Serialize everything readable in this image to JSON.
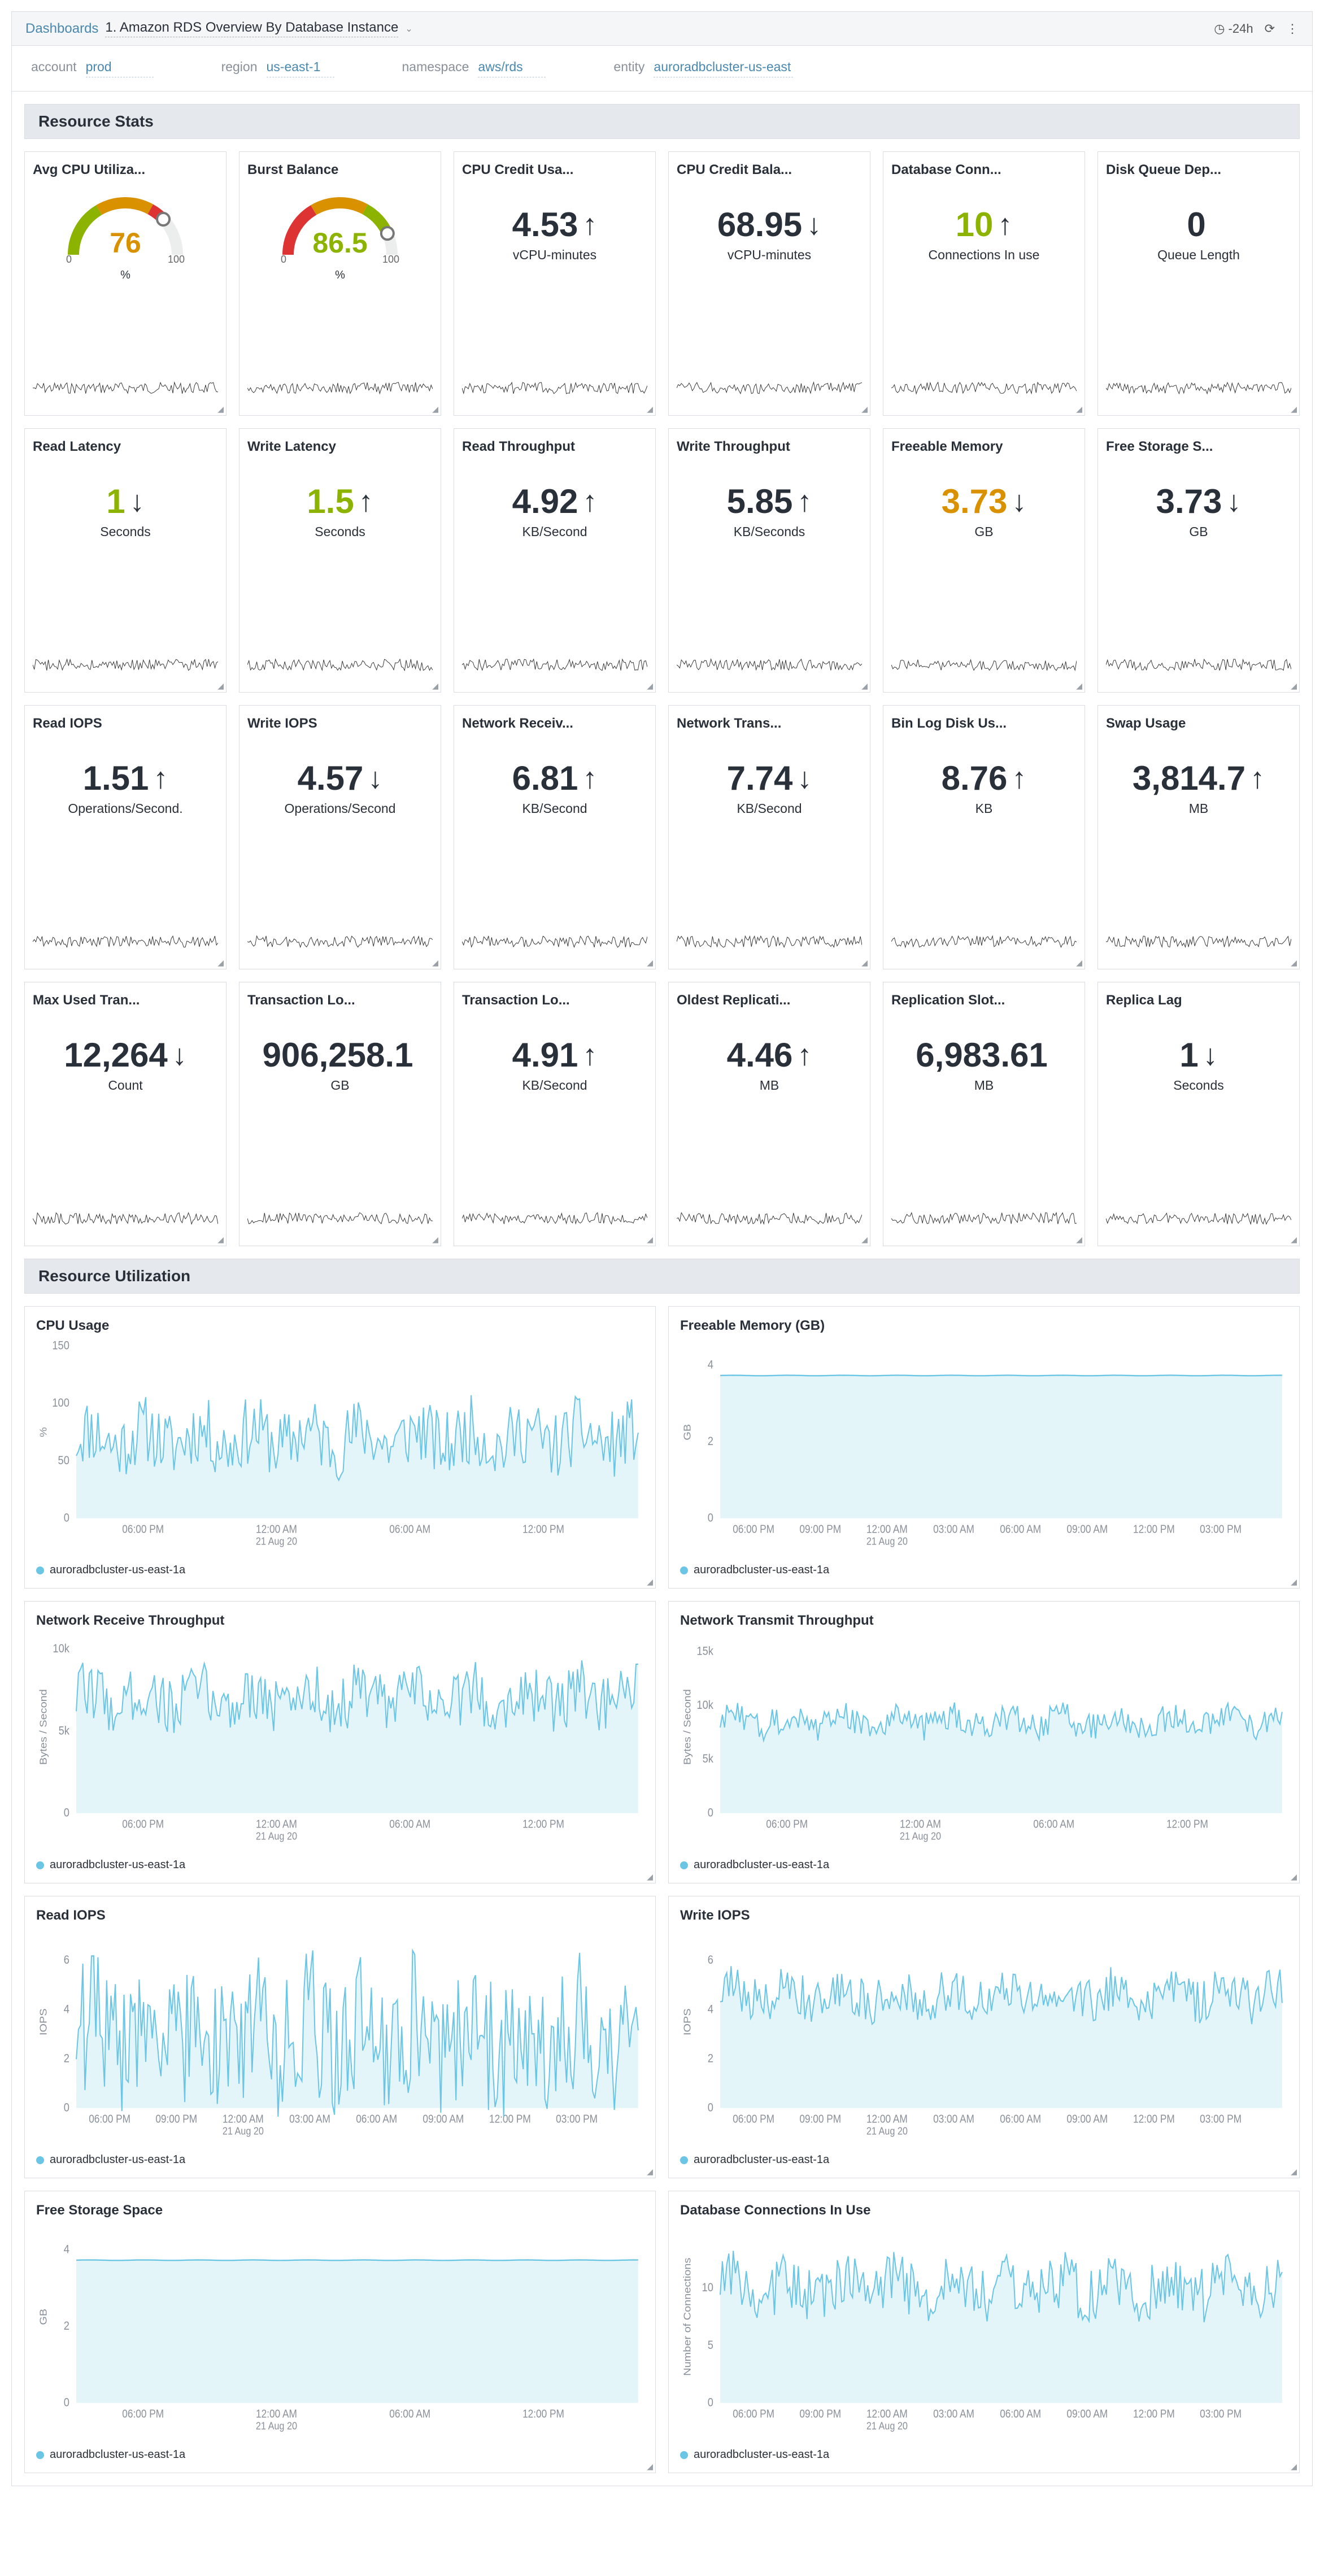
{
  "crumb": {
    "label": "Dashboards",
    "title": "1. Amazon RDS Overview By Database Instance"
  },
  "timerange": "-24h",
  "filters": {
    "account": {
      "label": "account",
      "value": "prod"
    },
    "region": {
      "label": "region",
      "value": "us-east-1"
    },
    "namespace": {
      "label": "namespace",
      "value": "aws/rds"
    },
    "entity": {
      "label": "entity",
      "value": "auroradbcluster-us-east"
    }
  },
  "section1": "Resource Stats",
  "section2": "Resource Utilization",
  "legend_series": "auroradbcluster-us-east-1a",
  "stats": [
    {
      "title": "Avg CPU Utiliza...",
      "type": "gauge",
      "value": "76",
      "unit": "%",
      "color": "orange",
      "min": "0",
      "max": "100"
    },
    {
      "title": "Burst Balance",
      "type": "gauge",
      "value": "86.5",
      "unit": "%",
      "color": "green",
      "min": "0",
      "max": "100"
    },
    {
      "title": "CPU Credit Usa...",
      "value": "4.53",
      "arrow": "up",
      "unit": "vCPU-minutes"
    },
    {
      "title": "CPU Credit Bala...",
      "value": "68.95",
      "arrow": "down",
      "unit": "vCPU-minutes"
    },
    {
      "title": "Database Conn...",
      "value": "10",
      "arrow": "up",
      "unit": "Connections In use",
      "valcolor": "green"
    },
    {
      "title": "Disk Queue Dep...",
      "value": "0",
      "arrow": "",
      "unit": "Queue Length"
    },
    {
      "title": "Read Latency",
      "value": "1",
      "arrow": "down",
      "unit": "Seconds",
      "valcolor": "green"
    },
    {
      "title": "Write Latency",
      "value": "1.5",
      "arrow": "up",
      "unit": "Seconds",
      "valcolor": "green"
    },
    {
      "title": "Read Throughput",
      "value": "4.92",
      "arrow": "up",
      "unit": "KB/Second"
    },
    {
      "title": "Write Throughput",
      "value": "5.85",
      "arrow": "up",
      "unit": "KB/Seconds"
    },
    {
      "title": "Freeable Memory",
      "value": "3.73",
      "arrow": "down",
      "unit": "GB",
      "valcolor": "orange"
    },
    {
      "title": "Free Storage S...",
      "value": "3.73",
      "arrow": "down",
      "unit": "GB"
    },
    {
      "title": "Read IOPS",
      "value": "1.51",
      "arrow": "up",
      "unit": "Operations/Second."
    },
    {
      "title": "Write IOPS",
      "value": "4.57",
      "arrow": "down",
      "unit": "Operations/Second"
    },
    {
      "title": "Network Receiv...",
      "value": "6.81",
      "arrow": "up",
      "unit": "KB/Second"
    },
    {
      "title": "Network Trans...",
      "value": "7.74",
      "arrow": "down",
      "unit": "KB/Second"
    },
    {
      "title": "Bin Log Disk Us...",
      "value": "8.76",
      "arrow": "up",
      "unit": "KB"
    },
    {
      "title": "Swap Usage",
      "value": "3,814.7",
      "arrow": "up",
      "unit": "MB"
    },
    {
      "title": "Max Used Tran...",
      "value": "12,264",
      "arrow": "down",
      "unit": "Count"
    },
    {
      "title": "Transaction Lo...",
      "value": "906,258.1",
      "arrow": "",
      "unit": "GB"
    },
    {
      "title": "Transaction Lo...",
      "value": "4.91",
      "arrow": "up",
      "unit": "KB/Second"
    },
    {
      "title": "Oldest Replicati...",
      "value": "4.46",
      "arrow": "up",
      "unit": "MB"
    },
    {
      "title": "Replication Slot...",
      "value": "6,983.61",
      "arrow": "",
      "unit": "MB"
    },
    {
      "title": "Replica Lag",
      "value": "1",
      "arrow": "down",
      "unit": "Seconds"
    }
  ],
  "charts": [
    {
      "title": "CPU Usage",
      "ylabel": "%",
      "ymax": 150,
      "yticks": [
        0,
        50,
        100,
        150
      ],
      "xaxis": "long",
      "base": 70,
      "amp": 25,
      "noise": 1.2
    },
    {
      "title": "Freeable Memory (GB)",
      "ylabel": "GB",
      "ymax": 4.5,
      "yticks": [
        0,
        2,
        4
      ],
      "xaxis": "short",
      "base": 3.73,
      "amp": 0.02,
      "noise": 0.02
    },
    {
      "title": "Network Receive Throughput",
      "ylabel": "Bytes / Second",
      "ymax": 10500,
      "yticks": [
        0,
        5000,
        10000
      ],
      "ytickfmt": "k",
      "xaxis": "long",
      "base": 7000,
      "amp": 1800,
      "noise": 1.0
    },
    {
      "title": "Network Transmit Throughput",
      "ylabel": "Bytes / Second",
      "ymax": 16000,
      "yticks": [
        0,
        5000,
        10000,
        15000
      ],
      "ytickfmt": "k",
      "xaxis": "long",
      "base": 8500,
      "amp": 1500,
      "noise": 0.9
    },
    {
      "title": "Read IOPS",
      "ylabel": "IOPS",
      "ymax": 7,
      "yticks": [
        0,
        2,
        4,
        6
      ],
      "xaxis": "short",
      "base": 3,
      "amp": 2.2,
      "noise": 1.3
    },
    {
      "title": "Write IOPS",
      "ylabel": "IOPS",
      "ymax": 7,
      "yticks": [
        0,
        2,
        4,
        6
      ],
      "xaxis": "short",
      "base": 4.6,
      "amp": 1.0,
      "noise": 0.9
    },
    {
      "title": "Free Storage Space",
      "ylabel": "GB",
      "ymax": 4.5,
      "yticks": [
        0,
        2,
        4
      ],
      "xaxis": "long",
      "base": 3.73,
      "amp": 0.02,
      "noise": 0.02
    },
    {
      "title": "Database Connections In Use",
      "ylabel": "Number of Connections",
      "ymax": 15,
      "yticks": [
        0,
        5,
        10
      ],
      "xaxis": "short",
      "base": 10,
      "amp": 2.5,
      "noise": 1.0
    }
  ],
  "chart_data": [
    {
      "type": "line",
      "title": "CPU Usage",
      "xlabel": "",
      "ylabel": "%",
      "ylim": [
        0,
        150
      ],
      "series": [
        {
          "name": "auroradbcluster-us-east-1a",
          "approx_mean": 70,
          "approx_range": [
            40,
            110
          ]
        }
      ],
      "x_range": "06:00 PM 20 Aug – 05:00 PM 21 Aug"
    },
    {
      "type": "line",
      "title": "Freeable Memory (GB)",
      "ylabel": "GB",
      "ylim": [
        0,
        4.5
      ],
      "series": [
        {
          "name": "auroradbcluster-us-east-1a",
          "approx_mean": 3.73,
          "approx_range": [
            3.7,
            3.78
          ]
        }
      ]
    },
    {
      "type": "line",
      "title": "Network Receive Throughput",
      "ylabel": "Bytes / Second",
      "ylim": [
        0,
        10500
      ],
      "series": [
        {
          "name": "auroradbcluster-us-east-1a",
          "approx_mean": 7000,
          "approx_range": [
            4500,
            9800
          ]
        }
      ]
    },
    {
      "type": "line",
      "title": "Network Transmit Throughput",
      "ylabel": "Bytes / Second",
      "ylim": [
        0,
        16000
      ],
      "series": [
        {
          "name": "auroradbcluster-us-east-1a",
          "approx_mean": 8500,
          "approx_range": [
            6500,
            12500
          ]
        }
      ]
    },
    {
      "type": "line",
      "title": "Read IOPS",
      "ylabel": "IOPS",
      "ylim": [
        0,
        7
      ],
      "series": [
        {
          "name": "auroradbcluster-us-east-1a",
          "approx_mean": 3,
          "approx_range": [
            0.5,
            6.5
          ]
        }
      ]
    },
    {
      "type": "line",
      "title": "Write IOPS",
      "ylabel": "IOPS",
      "ylim": [
        0,
        7
      ],
      "series": [
        {
          "name": "auroradbcluster-us-east-1a",
          "approx_mean": 4.6,
          "approx_range": [
            3,
            6.5
          ]
        }
      ]
    },
    {
      "type": "line",
      "title": "Free Storage Space",
      "ylabel": "GB",
      "ylim": [
        0,
        4.5
      ],
      "series": [
        {
          "name": "auroradbcluster-us-east-1a",
          "approx_mean": 3.73,
          "approx_range": [
            3.7,
            3.78
          ]
        }
      ]
    },
    {
      "type": "line",
      "title": "Database Connections In Use",
      "ylabel": "Number of Connections",
      "ylim": [
        0,
        15
      ],
      "series": [
        {
          "name": "auroradbcluster-us-east-1a",
          "approx_mean": 10,
          "approx_range": [
            6,
            13
          ]
        }
      ]
    }
  ],
  "xaxis": {
    "long": [
      {
        "l1": "06:00 PM"
      },
      {
        "l1": "12:00 AM",
        "l2": "21 Aug 20"
      },
      {
        "l1": "06:00 AM"
      },
      {
        "l1": "12:00 PM"
      }
    ],
    "short": [
      {
        "l1": "06:00 PM"
      },
      {
        "l1": "09:00 PM"
      },
      {
        "l1": "12:00 AM",
        "l2": "21 Aug 20"
      },
      {
        "l1": "03:00 AM"
      },
      {
        "l1": "06:00 AM"
      },
      {
        "l1": "09:00 AM"
      },
      {
        "l1": "12:00 PM"
      },
      {
        "l1": "03:00 PM"
      }
    ]
  }
}
